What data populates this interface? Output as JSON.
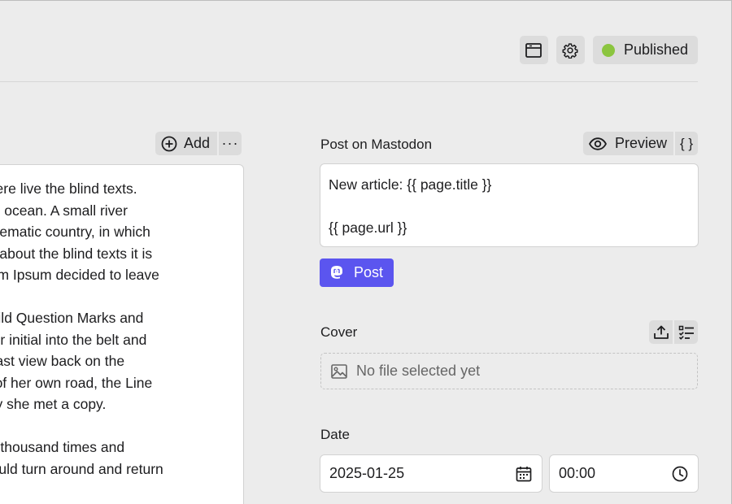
{
  "toolbar": {
    "window_icon": "window-icon",
    "settings_icon": "gear-icon",
    "status_label": "Published",
    "status_color": "#8bc53f"
  },
  "editor": {
    "add_label": "Add",
    "more_label": "···",
    "paragraphs": [
      [
        "ntia, there live the blind texts.",
        "nguage ocean. A small river",
        "paradisematic country, in which",
        "control about the blind texts it is",
        "of Lorem Ipsum decided to leave"
      ],
      [
        "mas, wild Question Marks and",
        ", put her initial into the belt and",
        "had a last view back on the",
        "ubline of her own road, the Line",
        "her way she met a copy."
      ],
      [
        "ritten a thousand times and",
        "ext should turn around and return"
      ]
    ]
  },
  "mastodon": {
    "label": "Post on Mastodon",
    "preview_label": "Preview",
    "braces_label": "{ }",
    "lines": [
      "New article: {{ page.title }}",
      "",
      "{{ page.url }}"
    ],
    "post_label": "Post",
    "accent": "#5b55ef"
  },
  "cover": {
    "label": "Cover",
    "empty_text": "No file selected yet"
  },
  "date": {
    "label": "Date",
    "date_value": "2025-01-25",
    "time_value": "00:00"
  }
}
